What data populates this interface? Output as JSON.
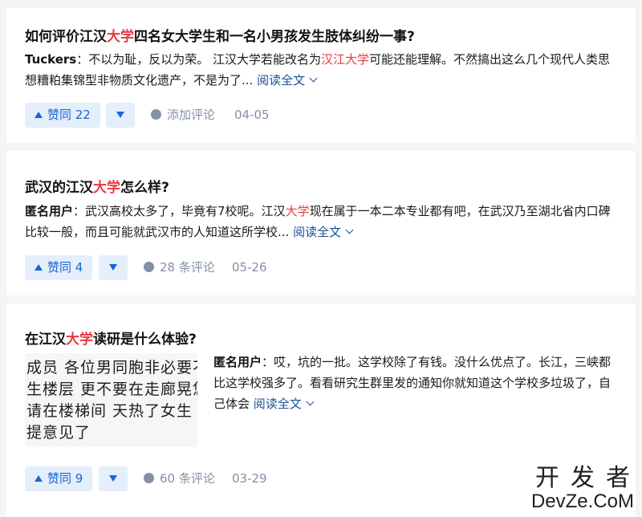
{
  "answers": [
    {
      "title_pre": "如何评价江汉",
      "title_hl": "大学",
      "title_post": "四名女大学生和一名小男孩发生肢体纠纷一事?",
      "author": "Tuckers",
      "excerpt_pre": "：不以为耻，反以为荣。 江汉大学若能改名为",
      "excerpt_hl": "汉江大学",
      "excerpt_post": "可能还能理解。不然搞出这么几个现代人类思想糟粕集锦型非物质文化遗产，不是为了...",
      "read_more": "阅读全文",
      "upvote_label": "赞同 22",
      "comment_label": "添加评论",
      "date": "04-05"
    },
    {
      "title_pre": "武汉的江汉",
      "title_hl": "大学",
      "title_post": "怎么样?",
      "author": "匿名用户",
      "excerpt_pre": "：武汉高校太多了，毕竟有7校呢。江汉",
      "excerpt_hl": "大学",
      "excerpt_post": "现在属于一本二本专业都有吧，在武汉乃至湖北省内口碑比较一般，而且可能就武汉市的人知道这所学校...",
      "read_more": "阅读全文",
      "upvote_label": "赞同 4",
      "comment_label": "28 条评论",
      "date": "05-26"
    },
    {
      "title_pre": "在江汉",
      "title_hl": "大学",
      "title_post": "读研是什么体验?",
      "author": "匿名用户",
      "excerpt_pre": "：哎，坑的一批。这学校除了有钱。没什么优点了。长江，三峡都比这学校强多了。看看研究生群里发的通知你就知道这个学校多垃圾了，自己体会",
      "excerpt_hl": "",
      "excerpt_post": "",
      "read_more": "阅读全文",
      "upvote_label": "赞同 9",
      "comment_label": "60 条评论",
      "date": "03-29",
      "thumbnail_lines": [
        "成员 各位男同胞非必要不",
        "生楼层 更不要在走廊晃悠",
        "请在楼梯间  天热了女生",
        "提意见了"
      ]
    }
  ],
  "watermark": {
    "cn": "开发者",
    "en": "DevZe.CoM"
  },
  "colors": {
    "highlight": "#e8393f",
    "link": "#175199",
    "vote_bg": "#e5eefb",
    "vote_fg": "#1766d6",
    "meta": "#8590a6"
  },
  "icons": [
    "triangle-up-icon",
    "triangle-down-icon",
    "comment-icon",
    "chevron-down-icon"
  ]
}
